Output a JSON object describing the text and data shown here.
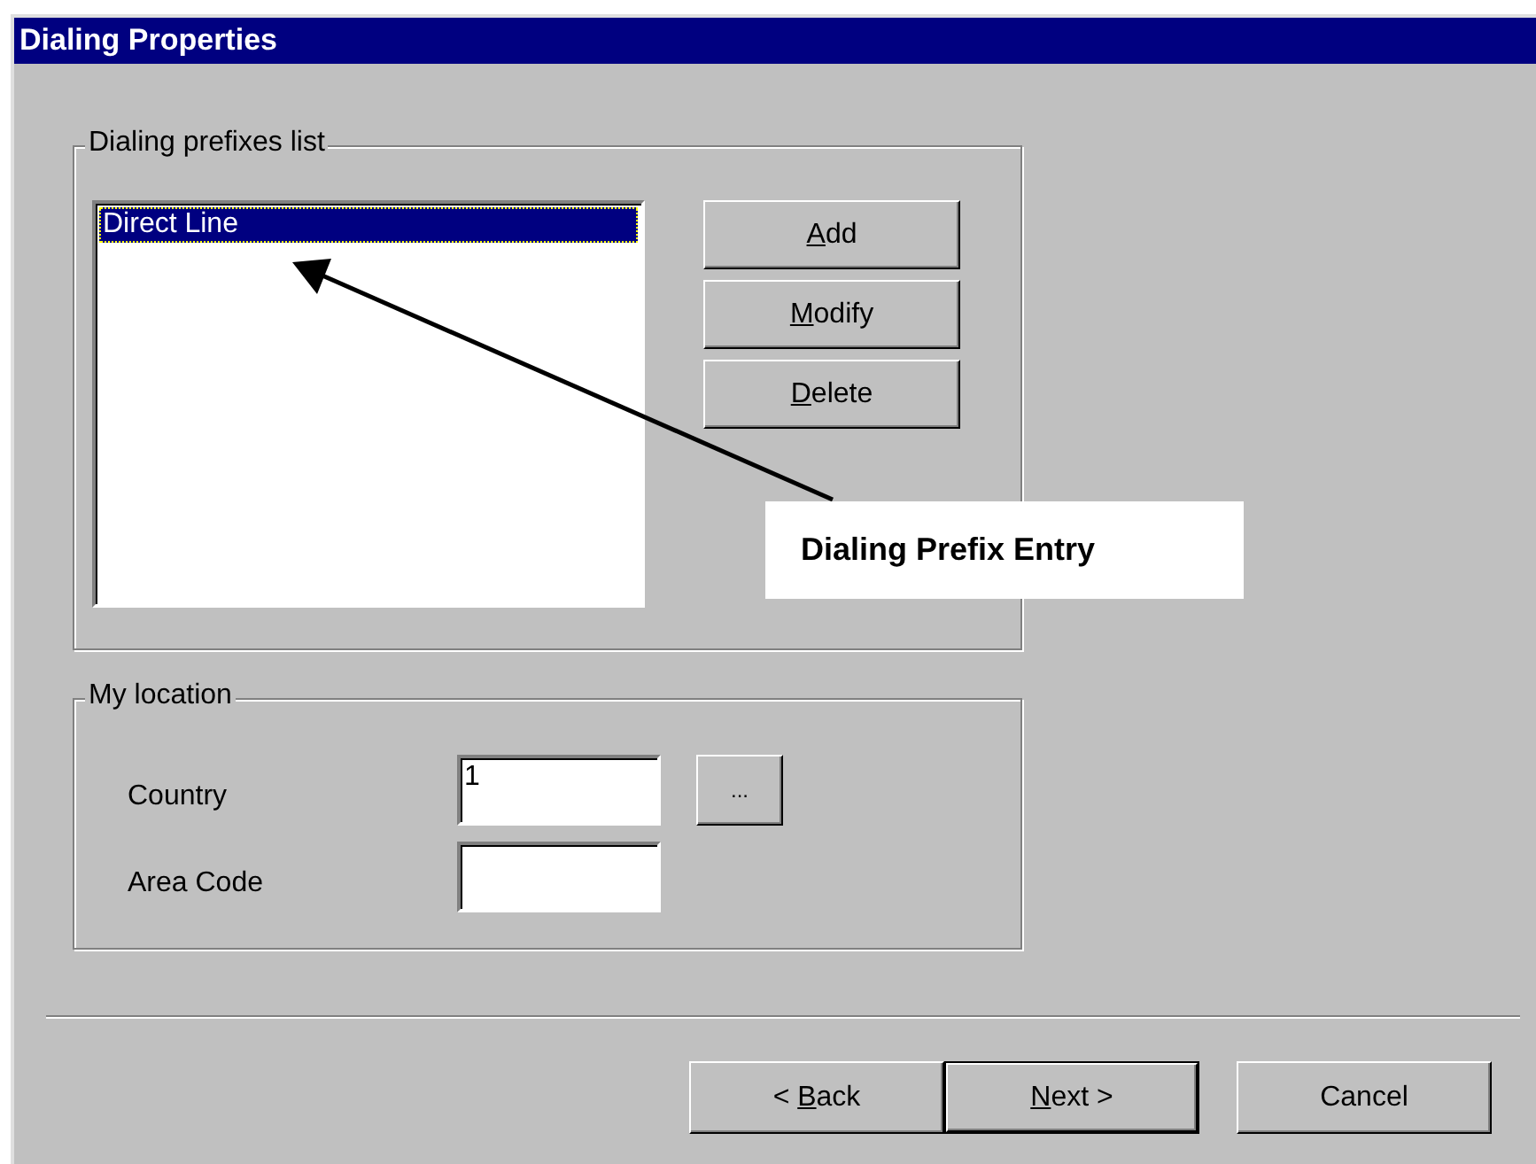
{
  "window": {
    "title": "Dialing Properties"
  },
  "prefixes_group": {
    "legend": "Dialing prefixes list",
    "items": [
      {
        "text": "Direct Line",
        "selected": true
      }
    ],
    "buttons": [
      {
        "parts": [
          {
            "text": "A",
            "underlined": true
          },
          {
            "text": "dd",
            "underlined": false
          }
        ]
      },
      {
        "parts": [
          {
            "text": "M",
            "underlined": true
          },
          {
            "text": "odify",
            "underlined": false
          }
        ]
      },
      {
        "parts": [
          {
            "text": "D",
            "underlined": true
          },
          {
            "text": "elete",
            "underlined": false
          }
        ]
      }
    ]
  },
  "callout": {
    "text": "Dialing Prefix Entry"
  },
  "location_group": {
    "legend": "My location",
    "country": {
      "label": "Country",
      "value": "1",
      "browse": "..."
    },
    "area_code": {
      "label": "Area Code"
    }
  },
  "footer_buttons": [
    {
      "parts": [
        {
          "text": "< ",
          "underlined": false
        },
        {
          "text": "B",
          "underlined": true
        },
        {
          "text": "ack",
          "underlined": false
        }
      ],
      "default": false
    },
    {
      "parts": [
        {
          "text": "N",
          "underlined": true
        },
        {
          "text": "ext >",
          "underlined": false
        }
      ],
      "default": true
    },
    {
      "parts": [
        {
          "text": "Cancel",
          "underlined": false
        }
      ],
      "default": false
    }
  ]
}
